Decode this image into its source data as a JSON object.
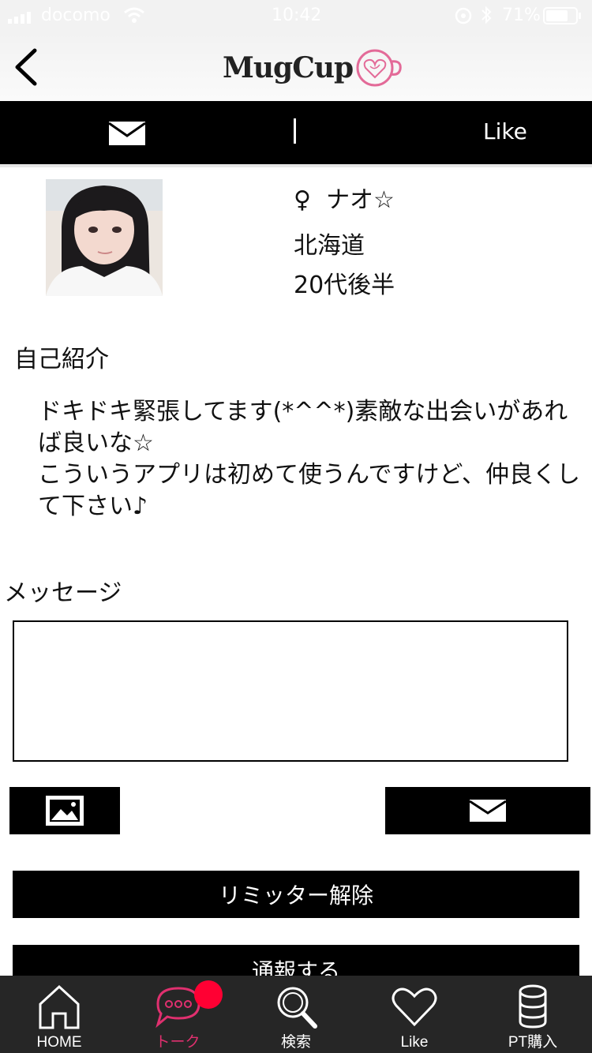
{
  "status_bar": {
    "carrier": "docomo",
    "time": "10:42",
    "battery": "71%"
  },
  "header": {
    "logo_text": "MugCup",
    "back_icon": "chevron-left-icon"
  },
  "top_bar": {
    "mail_icon": "mail-icon",
    "like_label": "Like"
  },
  "profile": {
    "gender_symbol": "♀",
    "name": "ナオ☆",
    "region": "北海道",
    "age": "20代後半"
  },
  "intro": {
    "heading": "自己紹介",
    "body": "ドキドキ緊張してます(*^^*)素敵な出会いがあれば良いな☆\nこういうアプリは初めて使うんですけど、仲良くして下さい♪"
  },
  "message": {
    "heading": "メッセージ",
    "value": "",
    "placeholder": ""
  },
  "buttons": {
    "image_icon": "image-icon",
    "send_icon": "mail-icon",
    "limiter": "リミッター解除",
    "report": "通報する"
  },
  "tabbar": {
    "items": [
      {
        "label": "HOME",
        "icon": "home-icon"
      },
      {
        "label": "トーク",
        "icon": "chat-icon",
        "active": true
      },
      {
        "label": "検索",
        "icon": "search-icon"
      },
      {
        "label": "Like",
        "icon": "heart-icon"
      },
      {
        "label": "PT購入",
        "icon": "coins-icon"
      }
    ]
  },
  "colors": {
    "active_tab": "#e0306f",
    "badge": "#ff0033",
    "bar": "#000000",
    "tabbar_bg": "#262626"
  }
}
